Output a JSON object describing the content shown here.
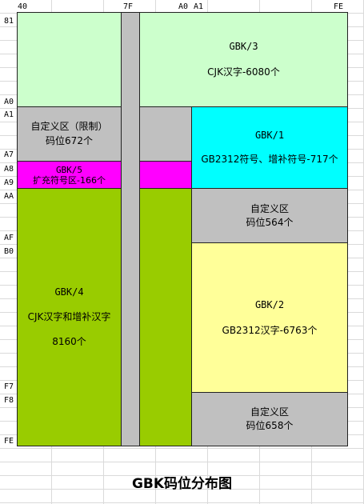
{
  "axes": {
    "top": {
      "c40": "40",
      "c7F": "7F",
      "cA0": "A0",
      "cA1": "A1",
      "cFE": "FE"
    },
    "left": {
      "r81": "81",
      "rA0": "A0",
      "rA1": "A1",
      "rA7": "A7",
      "rA8": "A8",
      "rA9": "A9",
      "rAA": "AA",
      "rAF": "AF",
      "rB0": "B0",
      "rF7": "F7",
      "rF8": "F8",
      "rFE": "FE"
    }
  },
  "regions": {
    "gbk3": {
      "name": "GBK/3",
      "desc": "CJK汉字-6080个"
    },
    "custom_limited": {
      "line1": "自定义区（限制）",
      "line2": "码位672个"
    },
    "gbk1": {
      "name": "GBK/1",
      "desc": "GB2312符号、增补符号-717个"
    },
    "gbk5": {
      "name": "GBK/5",
      "desc": "扩充符号区-166个"
    },
    "custom_564": {
      "line1": "自定义区",
      "line2": "码位564个"
    },
    "gbk4": {
      "name": "GBK/4",
      "desc": "CJK汉字和增补汉字",
      "count": "8160个"
    },
    "gbk2": {
      "name": "GBK/2",
      "desc": "GB2312汉字-6763个"
    },
    "custom_658": {
      "line1": "自定义区",
      "line2": "码位658个"
    }
  },
  "colors": {
    "gbk3": "#ccffcc",
    "gbk1": "#00ffff",
    "gbk5": "#ff00ff",
    "gbk4": "#99cc00",
    "gbk2": "#ffff99",
    "custom": "#c0c0c0",
    "gap": "#c0c0c0"
  },
  "caption": "GBK码位分布图"
}
